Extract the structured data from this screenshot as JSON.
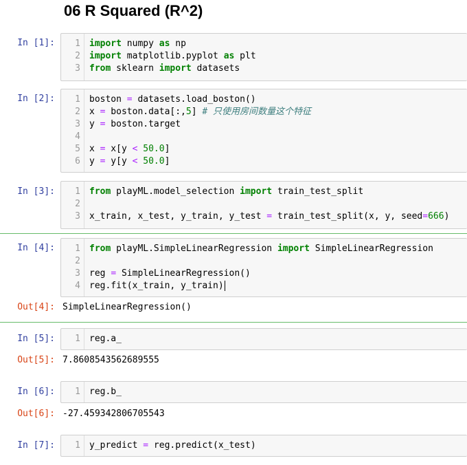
{
  "notebook": {
    "title": "06 R Squared (R^2)",
    "cells": [
      {
        "prompt": "In  [1]:",
        "lines": [
          {
            "n": "1",
            "tokens": [
              [
                "kw",
                "import"
              ],
              [
                "t",
                " numpy "
              ],
              [
                "kw",
                "as"
              ],
              [
                "t",
                " np"
              ]
            ]
          },
          {
            "n": "2",
            "tokens": [
              [
                "kw",
                "import"
              ],
              [
                "t",
                " matplotlib.pyplot "
              ],
              [
                "kw",
                "as"
              ],
              [
                "t",
                " plt"
              ]
            ]
          },
          {
            "n": "3",
            "tokens": [
              [
                "kw",
                "from"
              ],
              [
                "t",
                " sklearn "
              ],
              [
                "kw",
                "import"
              ],
              [
                "t",
                " datasets"
              ]
            ]
          }
        ]
      },
      {
        "prompt": "In  [2]:",
        "lines": [
          {
            "n": "1",
            "tokens": [
              [
                "t",
                "boston "
              ],
              [
                "op",
                "="
              ],
              [
                "t",
                " datasets.load_boston()"
              ]
            ]
          },
          {
            "n": "2",
            "tokens": [
              [
                "t",
                "x "
              ],
              [
                "op",
                "="
              ],
              [
                "t",
                " boston.data[:,"
              ],
              [
                "num",
                "5"
              ],
              [
                "t",
                "] "
              ],
              [
                "cm",
                "# 只使用房间数量这个特征"
              ]
            ]
          },
          {
            "n": "3",
            "tokens": [
              [
                "t",
                "y "
              ],
              [
                "op",
                "="
              ],
              [
                "t",
                " boston.target"
              ]
            ]
          },
          {
            "n": "4",
            "tokens": []
          },
          {
            "n": "5",
            "tokens": [
              [
                "t",
                "x "
              ],
              [
                "op",
                "="
              ],
              [
                "t",
                " x[y "
              ],
              [
                "op",
                "<"
              ],
              [
                "t",
                " "
              ],
              [
                "num",
                "50.0"
              ],
              [
                "t",
                "]"
              ]
            ]
          },
          {
            "n": "6",
            "tokens": [
              [
                "t",
                "y "
              ],
              [
                "op",
                "="
              ],
              [
                "t",
                " y[y "
              ],
              [
                "op",
                "<"
              ],
              [
                "t",
                " "
              ],
              [
                "num",
                "50.0"
              ],
              [
                "t",
                "]"
              ]
            ]
          }
        ]
      },
      {
        "prompt": "In  [3]:",
        "lines": [
          {
            "n": "1",
            "tokens": [
              [
                "kw",
                "from"
              ],
              [
                "t",
                " playML.model_selection "
              ],
              [
                "kw",
                "import"
              ],
              [
                "t",
                " train_test_split"
              ]
            ]
          },
          {
            "n": "2",
            "tokens": []
          },
          {
            "n": "3",
            "tokens": [
              [
                "t",
                "x_train, x_test, y_train, y_test "
              ],
              [
                "op",
                "="
              ],
              [
                "t",
                " train_test_split(x, y, seed"
              ],
              [
                "op",
                "="
              ],
              [
                "num",
                "666"
              ],
              [
                "t",
                ")"
              ]
            ]
          }
        ]
      },
      {
        "prompt": "In  [4]:",
        "lines": [
          {
            "n": "1",
            "tokens": [
              [
                "kw",
                "from"
              ],
              [
                "t",
                " playML.SimpleLinearRegression "
              ],
              [
                "kw",
                "import"
              ],
              [
                "t",
                " SimpleLinearRegression"
              ]
            ]
          },
          {
            "n": "2",
            "tokens": []
          },
          {
            "n": "3",
            "tokens": [
              [
                "t",
                "reg "
              ],
              [
                "op",
                "="
              ],
              [
                "t",
                " SimpleLinearRegression()"
              ]
            ]
          },
          {
            "n": "4",
            "tokens": [
              [
                "t",
                "reg.fit(x_train, y_train)"
              ]
            ]
          }
        ],
        "out_prompt": "Out[4]:",
        "output": "SimpleLinearRegression()"
      },
      {
        "prompt": "In  [5]:",
        "lines": [
          {
            "n": "1",
            "tokens": [
              [
                "t",
                "reg.a_"
              ]
            ]
          }
        ],
        "out_prompt": "Out[5]:",
        "output": "7.8608543562689555"
      },
      {
        "prompt": "In  [6]:",
        "lines": [
          {
            "n": "1",
            "tokens": [
              [
                "t",
                "reg.b_"
              ]
            ]
          }
        ],
        "out_prompt": "Out[6]:",
        "output": "-27.459342806705543"
      },
      {
        "prompt": "In  [7]:",
        "lines": [
          {
            "n": "1",
            "tokens": [
              [
                "t",
                "y_predict "
              ],
              [
                "op",
                "="
              ],
              [
                "t",
                " reg.predict(x_test)"
              ]
            ]
          }
        ]
      }
    ]
  }
}
